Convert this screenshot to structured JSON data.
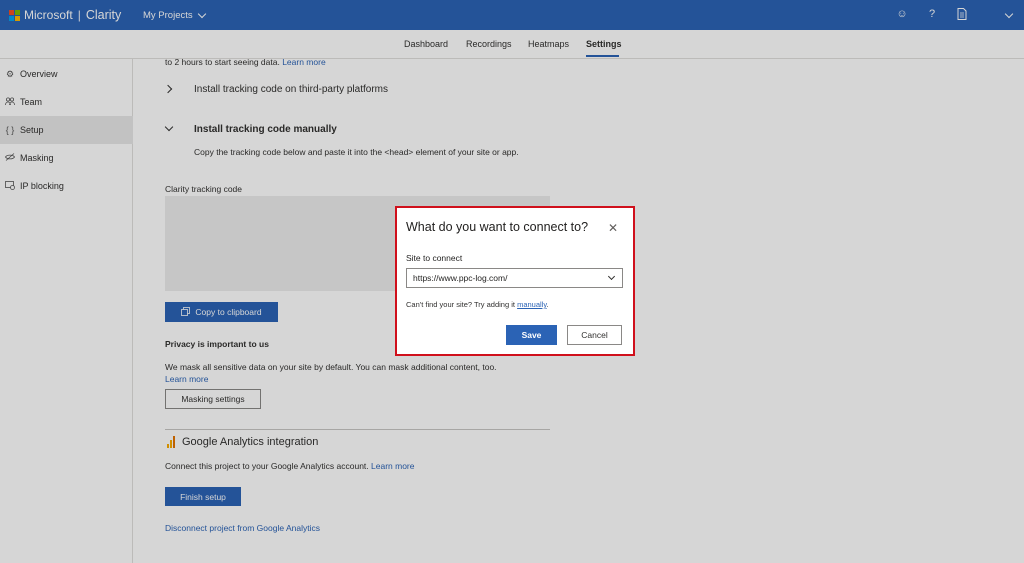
{
  "topbar": {
    "brand_name": "Microsoft",
    "product_name": "Clarity",
    "projects_label": "My Projects",
    "ms_colors": [
      "#f25022",
      "#7fba00",
      "#00a4ef",
      "#ffb900"
    ]
  },
  "tabs": [
    {
      "label": "Dashboard",
      "active": false
    },
    {
      "label": "Recordings",
      "active": false
    },
    {
      "label": "Heatmaps",
      "active": false
    },
    {
      "label": "Settings",
      "active": true
    }
  ],
  "sidebar": {
    "items": [
      {
        "label": "Overview",
        "icon": "gear-icon",
        "active": false
      },
      {
        "label": "Team",
        "icon": "team-icon",
        "active": false
      },
      {
        "label": "Setup",
        "icon": "code-icon",
        "active": true
      },
      {
        "label": "Masking",
        "icon": "masking-icon",
        "active": false
      },
      {
        "label": "IP blocking",
        "icon": "ip-blocking-icon",
        "active": false
      }
    ]
  },
  "main": {
    "intro_text": "to 2 hours to start seeing data.",
    "intro_link": "Learn more",
    "third_party_heading": "Install tracking code on third-party platforms",
    "manual_heading": "Install tracking code manually",
    "manual_desc": "Copy the tracking code below and paste it into the <head> element of your site or app.",
    "tracking_code_label": "Clarity tracking code",
    "copy_button": "Copy to clipboard",
    "privacy_heading": "Privacy is important to us",
    "privacy_text": "We mask all sensitive data on your site by default. You can mask additional content, too.",
    "privacy_link": "Learn more",
    "masking_button": "Masking settings",
    "ga_heading": "Google Analytics integration",
    "ga_text": "Connect this project to your Google Analytics account.",
    "ga_link": "Learn more",
    "finish_button": "Finish setup",
    "disconnect_link": "Disconnect project from Google Analytics"
  },
  "modal": {
    "title": "What do you want to connect to?",
    "site_label": "Site to connect",
    "site_value": "https://www.ppc-log.com/",
    "hint_text": "Can't find your site? Try adding it",
    "hint_link": "manually",
    "hint_end": ".",
    "save_button": "Save",
    "cancel_button": "Cancel"
  }
}
